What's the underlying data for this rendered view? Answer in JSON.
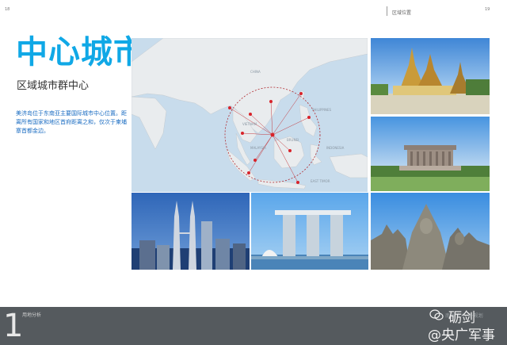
{
  "header": {
    "page_number_left": "18",
    "section_label": "区域位置",
    "page_number_right": "19"
  },
  "content": {
    "title": "中心城市",
    "subtitle": "区域城市群中心",
    "description": "美济岛位于东南亚主要国际城市中心位置。距离所有国家和地区首府距离之和，仅次于柬埔寨首都金边。"
  },
  "map": {
    "labels": [
      "CHINA",
      "PHILIPPINES",
      "VIETNAM",
      "MALAYSIA",
      "INDONESIA",
      "EAST TIMOR",
      "BRUNEI"
    ],
    "ocean_color": "#c8dcec",
    "land_color": "#e9ecee",
    "city_color": "#d8232a",
    "circle_color": "#b0282e"
  },
  "photos": [
    {
      "name": "grand-palace-photo"
    },
    {
      "name": "mausoleum-photo"
    },
    {
      "name": "petronas-towers-photo"
    },
    {
      "name": "marina-bay-sands-photo"
    },
    {
      "name": "bayon-temple-photo"
    }
  ],
  "footer": {
    "chapter_number": "1",
    "chapter_label": "用地分析",
    "faint_text": "南海·大小 海·规划",
    "watermark_line1": "砺剑",
    "watermark_line2": "@央广军事",
    "bar_color": "#555a5e"
  }
}
